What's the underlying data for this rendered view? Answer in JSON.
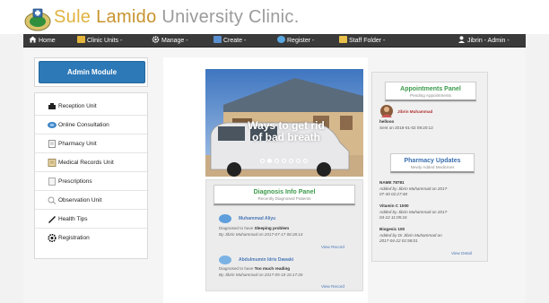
{
  "header": {
    "brand": [
      "Sule",
      "Lamido",
      "University",
      "Clinic."
    ]
  },
  "nav": [
    {
      "label": "Home",
      "icon": "home-icon",
      "caret": false
    },
    {
      "label": "Clinic Units -",
      "icon": "clinic-icon",
      "caret": false
    },
    {
      "label": "Manage -",
      "icon": "gear-icon",
      "caret": false
    },
    {
      "label": "Create -",
      "icon": "create-icon",
      "caret": false
    },
    {
      "label": "Register -",
      "icon": "register-icon",
      "caret": false
    },
    {
      "label": "Staff Folder -",
      "icon": "folder-icon",
      "caret": false
    },
    {
      "label": "Jibrin - Admin -",
      "icon": "user-icon",
      "caret": false
    }
  ],
  "sidebar": {
    "title": "Admin Module",
    "items": [
      {
        "label": "Reception Unit",
        "icon": "reception-icon"
      },
      {
        "label": "Online Consultation",
        "icon": "consultation-icon"
      },
      {
        "label": "Pharmacy Unit",
        "icon": "pharmacy-icon"
      },
      {
        "label": "Medical Records Unit",
        "icon": "records-icon"
      },
      {
        "label": "Prescriptions",
        "icon": "prescription-icon"
      },
      {
        "label": "Observation Unit",
        "icon": "observation-icon"
      },
      {
        "label": "Health Tips",
        "icon": "tips-icon"
      },
      {
        "label": "Registration",
        "icon": "registration-icon"
      }
    ]
  },
  "hero": {
    "caption_line1": "Ways to get rid",
    "caption_line2": "of bad breath",
    "slides": 7,
    "active_slide": 2
  },
  "diagnosis": {
    "title": "Diagnosis Info Panel",
    "subtitle": "Recently Diagnosed Patients",
    "entries": [
      {
        "name": "Muhammad Aliyu",
        "diag_prefix": "Diagnosed to have",
        "diag": "Sleeping problem",
        "by": "By Jibrin Muhammad on 2017-07-17 06:28:14",
        "link": "View Record"
      },
      {
        "name": "Abdulmumin Idris Dawaki",
        "diag_prefix": "Diagnosed to have",
        "diag": "Too much reading",
        "by": "By Jibrin Muhammad on 2017-05-18 16:17:26",
        "link": "View Record"
      }
    ]
  },
  "appointments": {
    "title": "Appointments Panel",
    "subtitle": "Pending Appointments",
    "sender": "Jibrin Muhammad",
    "message": "hellooo",
    "sent": "Sent on 2018-01-02 09:20:12"
  },
  "pharmacy": {
    "title": "Pharmacy Updates",
    "subtitle": "Newly Added Medicines",
    "items": [
      {
        "name": "NAME 78781",
        "line1": "Added by Jibrin Muhammad on 2017-",
        "line2": "07-30 02:27:48"
      },
      {
        "name": "Vitamin C 1000",
        "line1": "Added by Jibrin Muhammad on 2017-",
        "line2": "04-22 11:05:16"
      },
      {
        "name": "Biogesic 100",
        "line1": "Added by Dr Jibrin Muhammad on",
        "line2": "2017-04-22 01:58:01"
      }
    ],
    "link": "View Detail"
  },
  "colors": {
    "brand_gold": "#e0b340",
    "nav_bg": "#3a3a3a",
    "admin_button": "#2d79b8",
    "panel_green": "#3b9a4a",
    "link_blue": "#4a79b8"
  }
}
